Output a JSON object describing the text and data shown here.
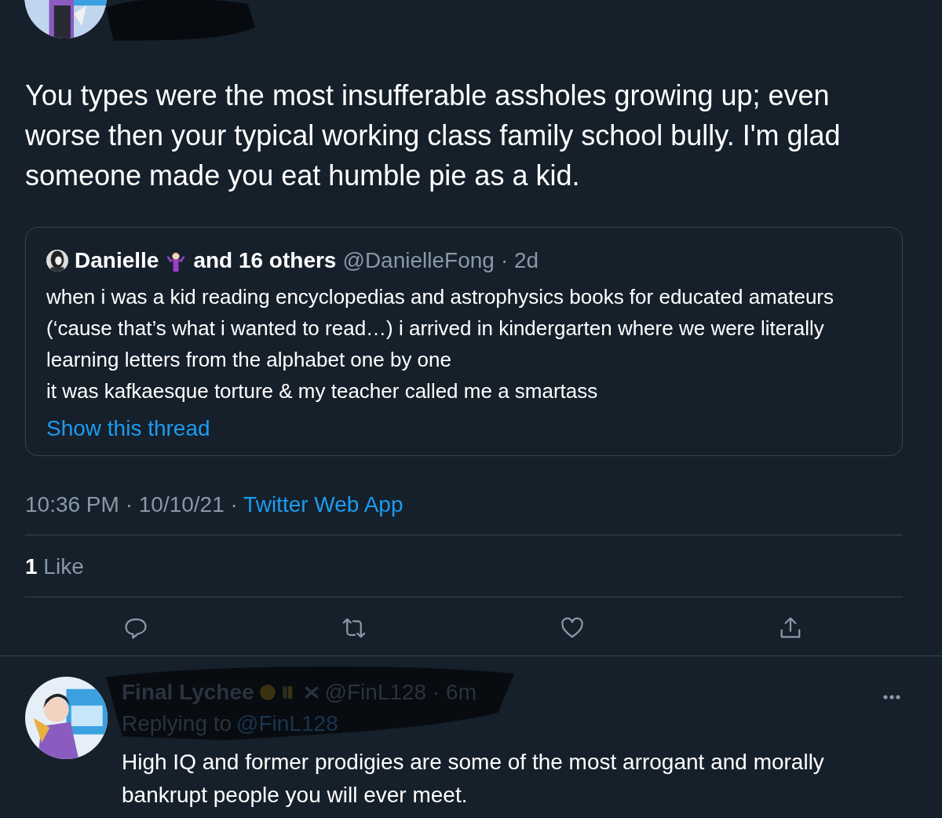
{
  "tweet": {
    "text": "You types were the most insufferable assholes growing up; even worse then your typical working class family school bully. I'm glad someone made you eat humble pie as a kid.",
    "quote": {
      "name": "Danielle",
      "others": "and 16 others",
      "handle": "@DanielleFong",
      "time": "· 2d",
      "text": "when i was a kid reading encyclopedias and astrophysics books for educated amateurs (‘cause that’s what i wanted to read…) i arrived in kindergarten where we were literally learning letters from the alphabet one by one\nit was kafkaesque torture & my teacher called me a smartass",
      "link": "Show this thread"
    },
    "time": "10:36 PM · 10/10/21 · ",
    "source": "Twitter Web App",
    "likes_count": "1",
    "likes_label": "Like"
  },
  "reply": {
    "name": "Final Lychee",
    "handle": "@FinL128 · 6m",
    "replying_label": "Replying to",
    "replying_handle": "@FinL128",
    "text": "High IQ and former prodigies are some of the most arrogant and morally bankrupt people you will ever meet."
  }
}
